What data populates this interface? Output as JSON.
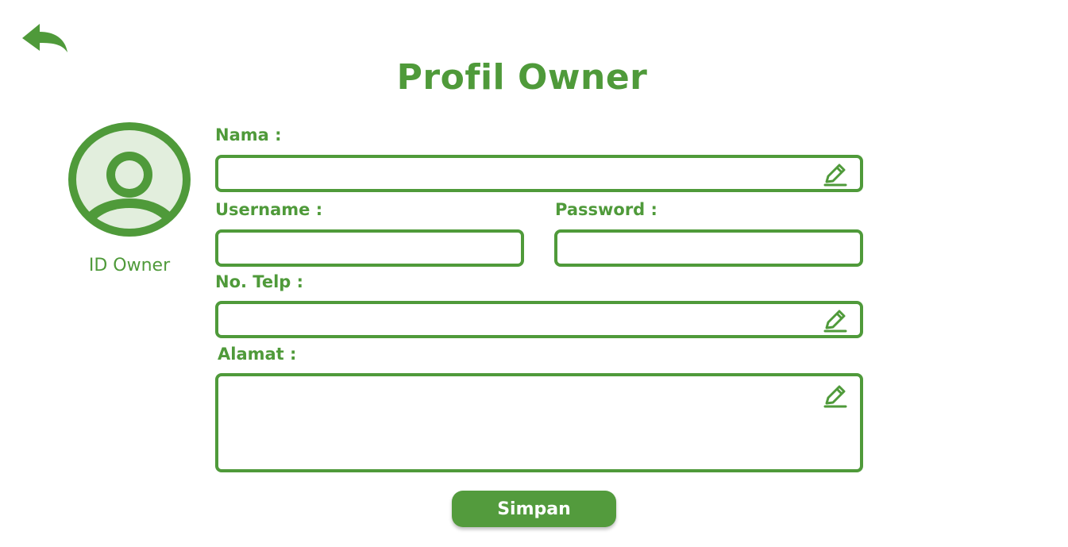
{
  "header": {
    "title": "Profil Owner",
    "back_icon": "back-arrow-icon"
  },
  "profile": {
    "avatar_icon": "user-avatar-icon",
    "id_label": "ID Owner"
  },
  "form": {
    "nama": {
      "label": "Nama :",
      "value": "",
      "edit_icon": "pencil-icon"
    },
    "username": {
      "label": "Username :",
      "value": ""
    },
    "password": {
      "label": "Password :",
      "value": ""
    },
    "telp": {
      "label": "No. Telp :",
      "value": "",
      "edit_icon": "pencil-icon"
    },
    "alamat": {
      "label": "Alamat :",
      "value": "",
      "edit_icon": "pencil-icon"
    },
    "save_label": "Simpan"
  },
  "colors": {
    "primary": "#4f9a3a",
    "button": "#539b3d",
    "avatar_fill": "#e2eedd",
    "background": "#ffffff"
  }
}
